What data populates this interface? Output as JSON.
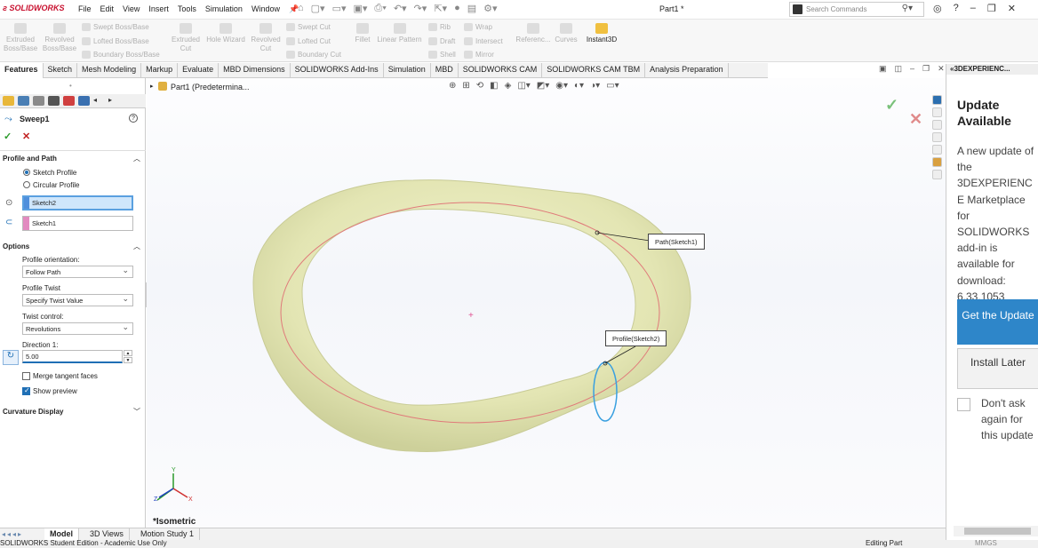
{
  "app": {
    "logo": "SOLIDWORKS",
    "doc_title": "Part1 *"
  },
  "menu": [
    "File",
    "Edit",
    "View",
    "Insert",
    "Tools",
    "Simulation",
    "Window"
  ],
  "search": {
    "placeholder": "Search Commands"
  },
  "ribbon": {
    "extruded_bossbase": [
      "Extruded",
      "Boss/Base"
    ],
    "revolved_bossbase": [
      "Revolved",
      "Boss/Base"
    ],
    "swept_bossbase": "Swept Boss/Base",
    "lofted_bossbase": "Lofted Boss/Base",
    "boundary_bossbase": "Boundary Boss/Base",
    "extruded_cut": [
      "Extruded",
      "Cut"
    ],
    "hole_wizard": "Hole Wizard",
    "revolved_cut": [
      "Revolved",
      "Cut"
    ],
    "swept_cut": "Swept Cut",
    "lofted_cut": "Lofted Cut",
    "boundary_cut": "Boundary Cut",
    "fillet": "Fillet",
    "linear_pattern": "Linear Pattern",
    "rib": "Rib",
    "draft": "Draft",
    "shell": "Shell",
    "wrap": "Wrap",
    "intersect": "Intersect",
    "mirror": "Mirror",
    "reference": "Referenc...",
    "curves": "Curves",
    "instant3d": "Instant3D"
  },
  "tabs": [
    "Features",
    "Sketch",
    "Mesh Modeling",
    "Markup",
    "Evaluate",
    "MBD Dimensions",
    "SOLIDWORKS Add-Ins",
    "Simulation",
    "MBD",
    "SOLIDWORKS CAM",
    "SOLIDWORKS CAM TBM",
    "Analysis Preparation"
  ],
  "property_manager": {
    "title": "Sweep1",
    "help": "?",
    "profile_and_path": {
      "heading": "Profile and Path",
      "option_sketch_profile": "Sketch Profile",
      "option_circular_profile": "Circular Profile",
      "selected_option": "Sketch Profile",
      "profile_value": "Sketch2",
      "path_value": "Sketch1"
    },
    "options": {
      "heading": "Options",
      "profile_orientation_label": "Profile orientation:",
      "profile_orientation_value": "Follow Path",
      "profile_twist_label": "Profile Twist",
      "profile_twist_value": "Specify Twist Value",
      "twist_control_label": "Twist control:",
      "twist_control_value": "Revolutions",
      "direction_label": "Direction 1:",
      "direction_value": "5.00",
      "merge_tangent_faces": "Merge tangent faces",
      "merge_tangent_checked": false,
      "show_preview": "Show preview",
      "show_preview_checked": true
    },
    "curvature_display": "Curvature Display"
  },
  "viewport": {
    "tree_root": "Part1 (Predetermina...",
    "callout_path": "Path(Sketch1)",
    "callout_profile": "Profile(Sketch2)",
    "view_name": "*Isometric",
    "axis_x": "X",
    "axis_y": "Y",
    "axis_z": "Z"
  },
  "task_pane": {
    "header": "3DEXPERIENC...",
    "title": "Update Available",
    "message": "A new update of the 3DEXPERIENCE Marketplace for SOLIDWORKS add-in is available for download: 6.33.1053",
    "primary_button": "Get the Update",
    "secondary_button": "Install Later",
    "dont_ask": "Don't ask again for this update"
  },
  "bottom_tabs": [
    "Model",
    "3D Views",
    "Motion Study 1"
  ],
  "status": {
    "left": "SOLIDWORKS Student Edition - Academic Use Only",
    "middle": "Editing Part",
    "units": "MMGS"
  },
  "colors": {
    "accent": "#1f77c5",
    "brand": "#c8102e",
    "model_fill": "#e8e9bd",
    "path_curve": "#e07a7a",
    "profile_curve": "#3aa0e0"
  }
}
